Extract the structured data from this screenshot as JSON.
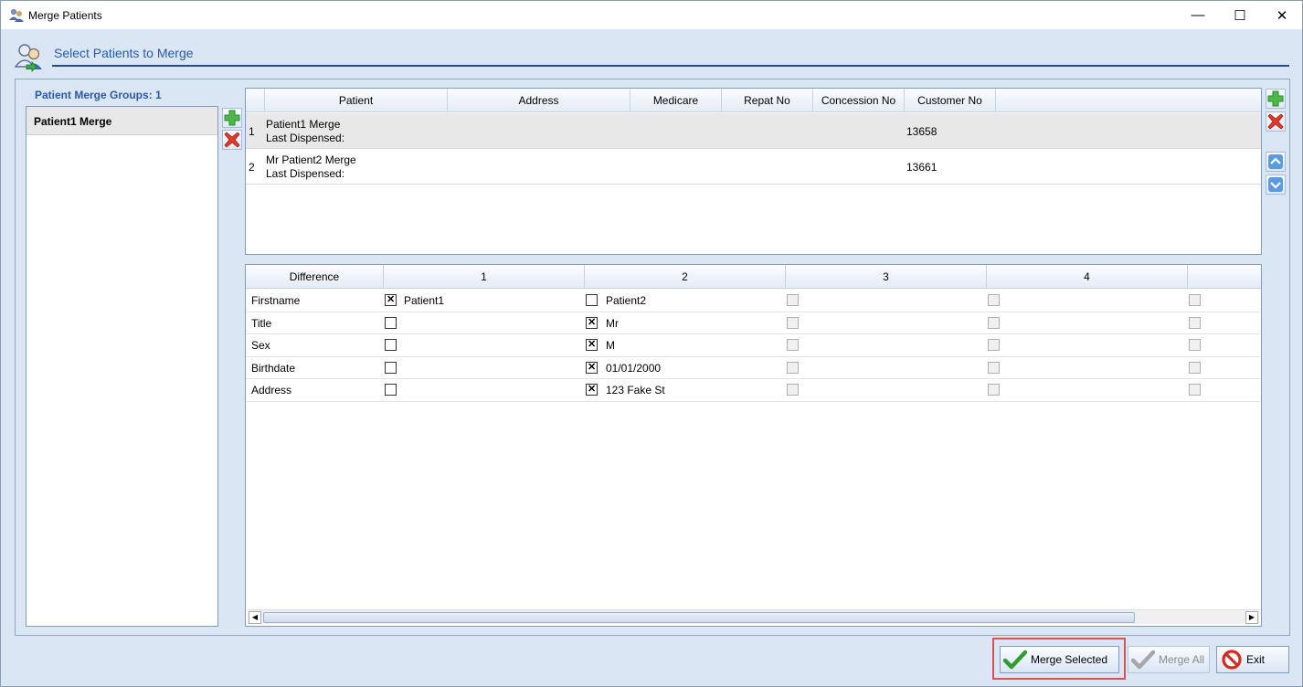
{
  "window": {
    "title": "Merge Patients",
    "controls": {
      "minimize": "—",
      "maximize": "☐",
      "close": "✕"
    }
  },
  "header": {
    "title": "Select Patients to Merge"
  },
  "groups": {
    "label": "Patient Merge Groups: 1",
    "items": [
      {
        "label": "Patient1 Merge"
      }
    ]
  },
  "patients_grid": {
    "columns": [
      "Patient",
      "Address",
      "Medicare",
      "Repat No",
      "Concession No",
      "Customer No"
    ],
    "rows": [
      {
        "num": "1",
        "name": "Patient1 Merge",
        "dispensed": "Last Dispensed:",
        "customer_no": "13658"
      },
      {
        "num": "2",
        "name": "Mr Patient2 Merge",
        "dispensed": "Last Dispensed:",
        "customer_no": "13661"
      }
    ]
  },
  "diff_grid": {
    "columns": [
      "Difference",
      "1",
      "2",
      "3",
      "4"
    ],
    "rows": [
      {
        "label": "Firstname",
        "v1": "Patient1",
        "c1": true,
        "v2": "Patient2",
        "c2": false
      },
      {
        "label": "Title",
        "v1": "",
        "c1": false,
        "v2": "Mr",
        "c2": true
      },
      {
        "label": "Sex",
        "v1": "",
        "c1": false,
        "v2": "M",
        "c2": true
      },
      {
        "label": "Birthdate",
        "v1": "",
        "c1": false,
        "v2": "01/01/2000",
        "c2": true
      },
      {
        "label": "Address",
        "v1": "",
        "c1": false,
        "v2": "123 Fake St",
        "c2": true
      }
    ]
  },
  "buttons": {
    "merge_selected": "Merge Selected",
    "merge_all": "Merge All",
    "exit": "Exit"
  },
  "colors": {
    "accent": "#2a5aa8",
    "highlight": "#d9534f"
  }
}
